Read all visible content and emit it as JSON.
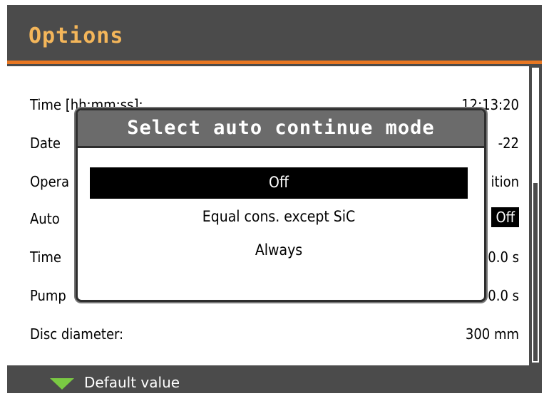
{
  "header": {
    "title": "Options"
  },
  "rows": [
    {
      "label": "Time [hh:mm:ss]:",
      "value": "12:13:20"
    },
    {
      "label": "Date",
      "value": "-22"
    },
    {
      "label": "Opera",
      "value": "ition"
    },
    {
      "label": "Auto",
      "value": "Off"
    },
    {
      "label": "Time",
      "value": ",0.0 s"
    },
    {
      "label": "Pump",
      "value": "0.0 s"
    },
    {
      "label": "Disc diameter:",
      "value": "300 mm"
    }
  ],
  "dialog": {
    "title": "Select auto continue mode",
    "options": [
      "Off",
      "Equal cons. except SiC",
      "Always"
    ],
    "selected_index": 0
  },
  "footer": {
    "hint_label": "Default value",
    "hint_icon": "down-triangle-icon",
    "hint_color": "#7ac943"
  },
  "colors": {
    "accent": "#e87722",
    "title": "#f4b65a",
    "frame": "#4b4b4b"
  }
}
